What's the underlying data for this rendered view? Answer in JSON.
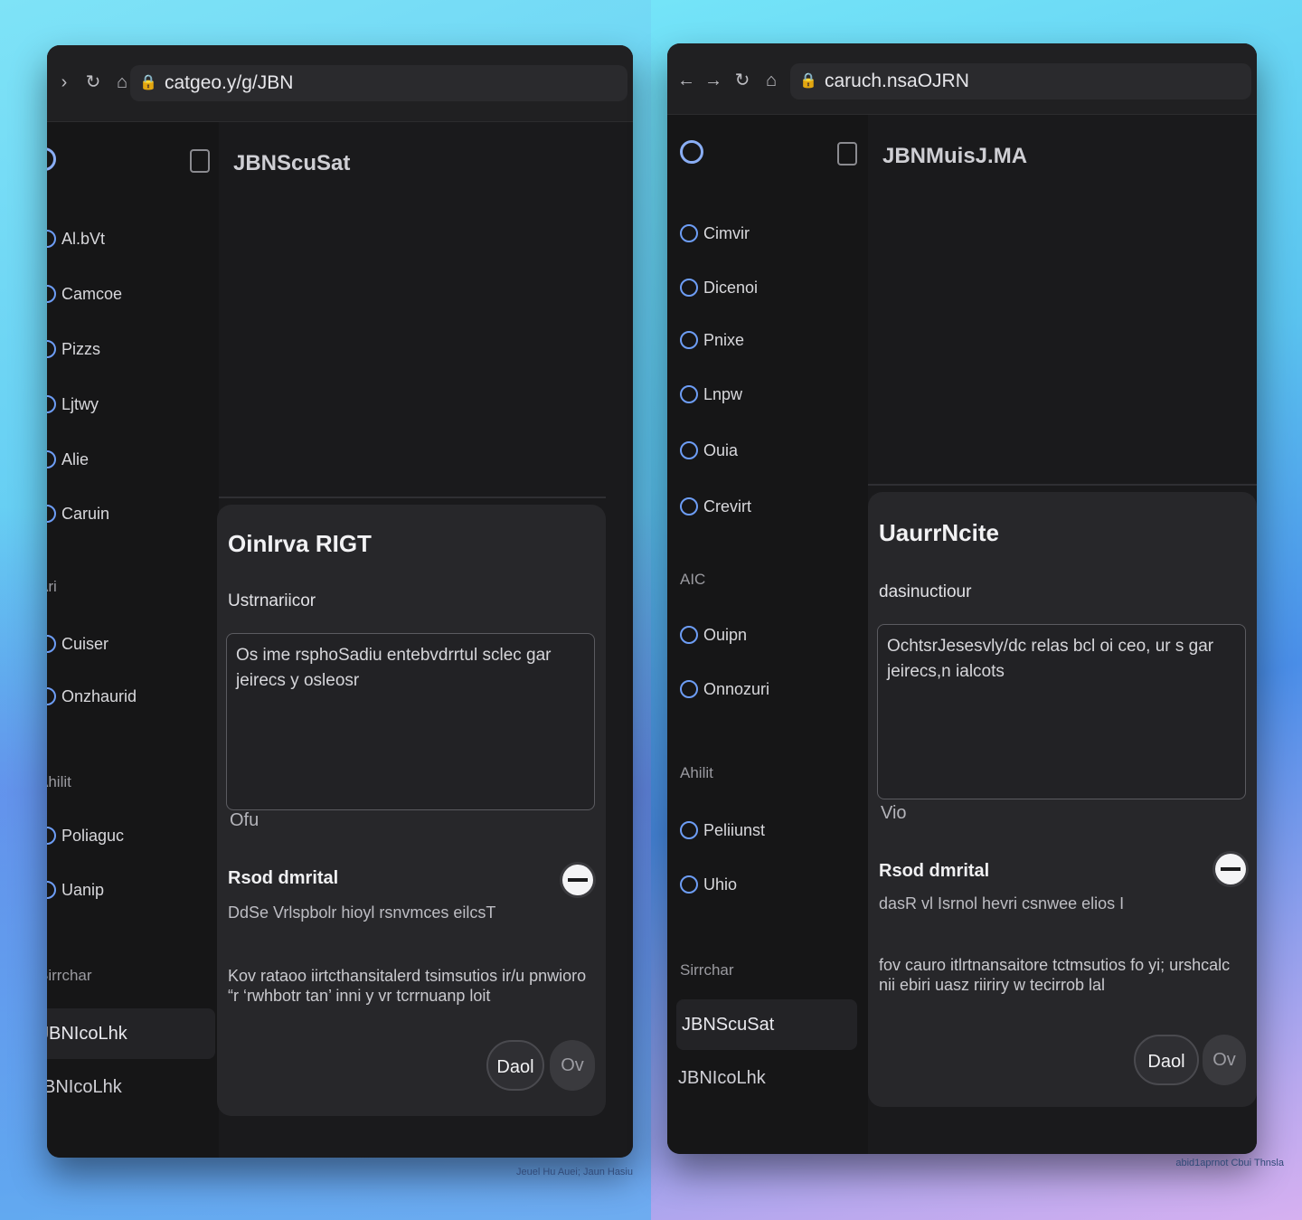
{
  "windows": [
    {
      "url": "catgeo.y/g/JBN",
      "app_title": "JBNScuSat",
      "sidebar_items": [
        "Al.bVt",
        "Camcoe",
        "Pizzs",
        "Ljtwy",
        "Alie",
        "Caruin"
      ],
      "sidebar_section_1": "Ari",
      "sidebar_items_2": [
        "Cuiser",
        "Onzhaurid"
      ],
      "sidebar_section_2": "Ahilit",
      "sidebar_items_3": [
        "Poliaguc",
        "Uanip"
      ],
      "sidebar_section_3": "Sirrchar",
      "sidebar_active": "JBNIcoLhk",
      "sidebar_footer": "JBNIcoLhk",
      "dialog": {
        "title": "OinIrva RIGT",
        "instructions_label": "Ustrnariicor",
        "instructions_text": "Os ime rsphoSadiu entebvdrrtul sclec gar jeirecs y osleosr",
        "counter": "Ofu",
        "toggle_title": "Rsod dmrital",
        "toggle_desc": "DdSe Vrlspbolr hioyl rsnvmces eilcsT",
        "para": "Kov rataoo iirtcthansitalerd tsimsutios ir/u pnwioro “r ‘rwhbotr tan’ inni y vr tcrrnuanp loit",
        "primary_button": "Daol",
        "secondary_button": "Ov"
      }
    },
    {
      "url": "caruch.nsaOJRN",
      "app_title": "JBNMuisJ.MA",
      "sidebar_items": [
        "Cimvir",
        "Dicenoi",
        "Pnixe",
        "Lnpw",
        "Ouia",
        "Crevirt"
      ],
      "sidebar_section_1": "AIC",
      "sidebar_items_2": [
        "Ouipn",
        "Onnozuri"
      ],
      "sidebar_section_2": "Ahilit",
      "sidebar_items_3": [
        "Peliiunst",
        "Uhio"
      ],
      "sidebar_section_3": "Sirrchar",
      "sidebar_active": "JBNScuSat",
      "sidebar_footer": "JBNIcoLhk",
      "dialog": {
        "title": "UaurrNcite",
        "instructions_label": "dasinuctiour",
        "instructions_text": "OchtsrJesesvly/dc relas bcl oi ceo, ur s gar jeirecs,n ialcots",
        "counter": "Vio",
        "toggle_title": "Rsod dmrital",
        "toggle_desc": "dasR vl Isrnol hevri csnwee elios I",
        "para": "fov cauro itlrtnansaitore tctmsutios fo yi; urshcalc nii ebiri uasz riiriry w tecirrob lal",
        "primary_button": "Daol",
        "secondary_button": "Ov"
      }
    }
  ],
  "watermarks": [
    "Jeuel Hu Auei; Jaun Hasiu",
    "abid1aprnot Cbui Thnsla"
  ]
}
